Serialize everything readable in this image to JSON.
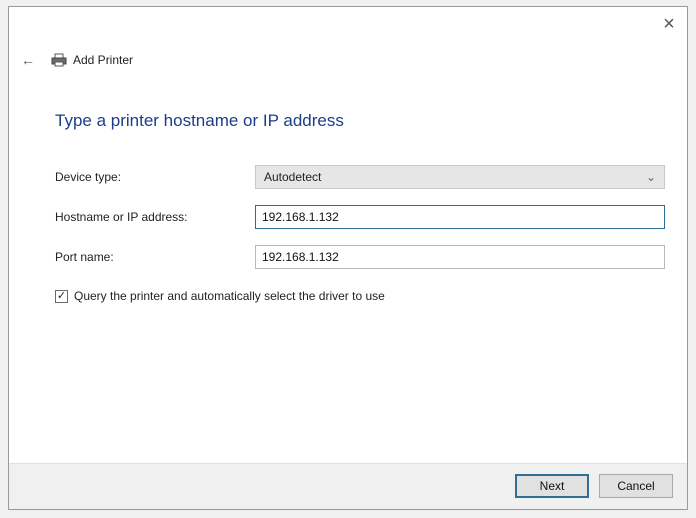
{
  "window": {
    "title": "Add Printer",
    "close_glyph": "×",
    "back_glyph": "←"
  },
  "page": {
    "heading": "Type a printer hostname or IP address"
  },
  "form": {
    "device_type_label": "Device type:",
    "device_type_value": "Autodetect",
    "hostname_label": "Hostname or IP address:",
    "hostname_value": "192.168.1.132",
    "port_label": "Port name:",
    "port_value": "192.168.1.132",
    "query_checkbox_label": "Query the printer and automatically select the driver to use",
    "query_checkbox_checked": true,
    "checkmark_glyph": "✓",
    "dropdown_glyph": "⌄"
  },
  "footer": {
    "next_label": "Next",
    "cancel_label": "Cancel"
  },
  "icons": {
    "close": "close-icon",
    "back": "back-arrow-icon",
    "printer": "printer-icon",
    "dropdown": "chevron-down-icon"
  },
  "colors": {
    "heading": "#1b3d8a",
    "focus_border": "#2f6f93"
  }
}
